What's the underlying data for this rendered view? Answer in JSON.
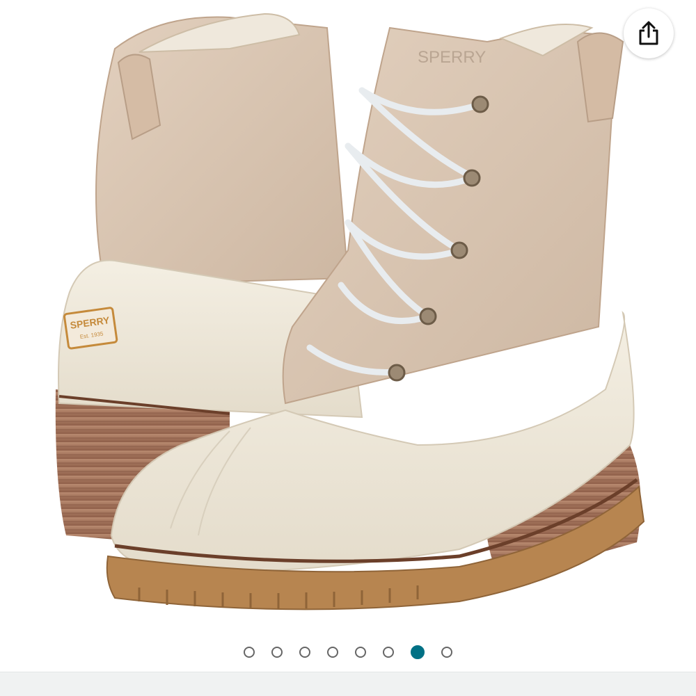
{
  "share": {
    "icon": "share-icon"
  },
  "image": {
    "alt_brand_text": "SPERRY",
    "brand_subtext": "Est. 1935",
    "background_color": "#ffffff",
    "upper_color": "#d9c6b4",
    "shell_color": "#eee8da",
    "heel_color": "#a3705a",
    "outsole_color": "#b78550"
  },
  "carousel": {
    "total": 8,
    "active_index": 6,
    "active_color": "#007185",
    "inactive_color": "#666666"
  }
}
